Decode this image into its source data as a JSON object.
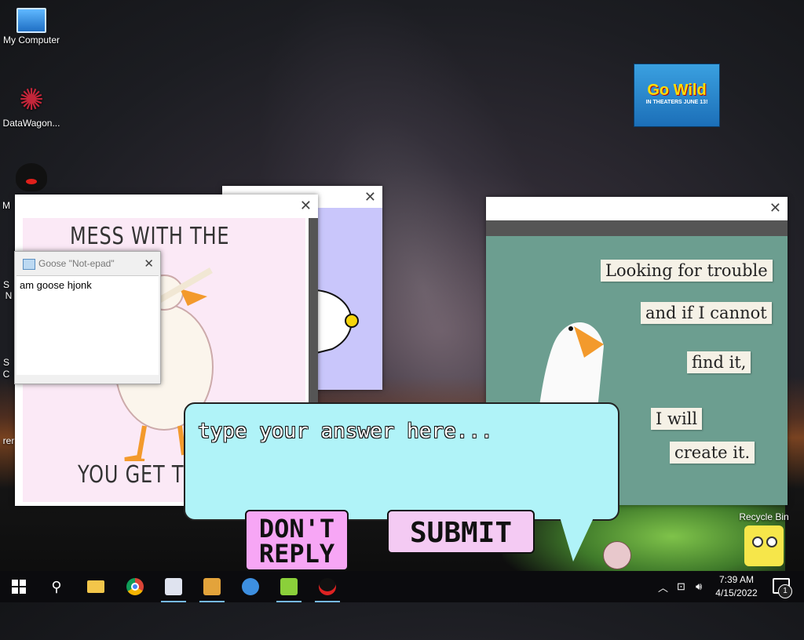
{
  "desktop": {
    "icons": [
      {
        "label": "My Computer"
      },
      {
        "label": "DataWagon..."
      }
    ],
    "partial_labels": [
      "M",
      "S",
      "N",
      "S",
      "C",
      "rer"
    ],
    "poster": {
      "line1": "Go Wild",
      "line2": "IN THEATERS JUNE 13!"
    },
    "recycle_bin": "Recycle Bin"
  },
  "windows": {
    "honk": {
      "top_text": "MESS WITH THE HONK",
      "bottom_text": "YOU GET TH"
    },
    "notepad": {
      "title": "Goose \"Not-epad\"",
      "content": "am goose hjonk"
    },
    "trouble": {
      "notes": [
        "Looking for trouble",
        "and if I cannot",
        "find it,",
        "I will",
        "create it."
      ]
    }
  },
  "dialog": {
    "placeholder": "type your answer here...",
    "dont_reply_line1": "DON'T",
    "dont_reply_line2": "REPLY",
    "submit_label": "SUBMIT"
  },
  "taskbar": {
    "time": "7:39 AM",
    "date": "4/15/2022",
    "notifications": "1"
  },
  "colors": {
    "bubble": "#b0f3f8",
    "dont_reply": "#f7a6f5",
    "submit": "#f4caf3",
    "honk_bg": "#fbe9f6",
    "trouble_bg": "#6c9e90"
  }
}
